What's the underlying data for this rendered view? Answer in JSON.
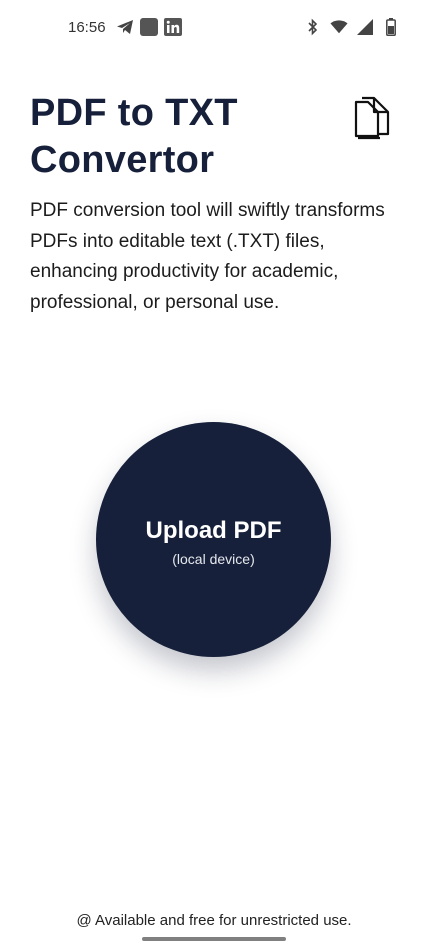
{
  "status_bar": {
    "time": "16:56",
    "left_icons": [
      "telegram-icon",
      "app-square-icon",
      "linkedin-icon"
    ],
    "right_icons": [
      "bluetooth-icon",
      "wifi-icon",
      "signal-icon",
      "battery-icon"
    ]
  },
  "header": {
    "title": "PDF to TXT Convertor",
    "icon": "documents-icon"
  },
  "description": "PDF conversion tool will swiftly transforms PDFs into editable text (.TXT) files, enhancing productivity for academic, professional, or personal use.",
  "upload": {
    "label": "Upload PDF",
    "sublabel": "(local device)"
  },
  "footer": {
    "text": "@ Available and free for unrestricted use."
  },
  "colors": {
    "primary": "#16203a",
    "background": "#ffffff"
  }
}
